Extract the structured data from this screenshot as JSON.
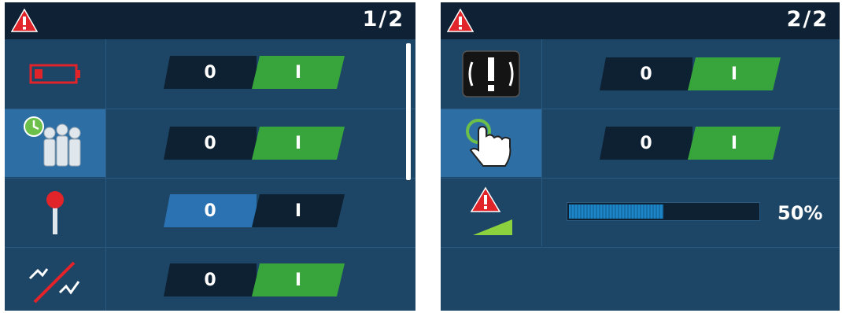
{
  "screens": [
    {
      "page_indicator": "1/2",
      "rows": [
        {
          "icon": "battery-low-icon",
          "toggle": {
            "off_label": "0",
            "on_label": "I",
            "state": "on"
          }
        },
        {
          "icon": "people-timer-icon",
          "selected": true,
          "toggle": {
            "off_label": "0",
            "on_label": "I",
            "state": "on"
          }
        },
        {
          "icon": "pin-icon",
          "toggle": {
            "off_label": "0",
            "on_label": "I",
            "state": "off"
          }
        },
        {
          "icon": "signal-disabled-icon",
          "toggle": {
            "off_label": "0",
            "on_label": "I",
            "state": "on"
          }
        }
      ]
    },
    {
      "page_indicator": "2/2",
      "rows": [
        {
          "icon": "alert-sign-icon",
          "toggle": {
            "off_label": "0",
            "on_label": "I",
            "state": "on"
          }
        },
        {
          "icon": "touch-hand-icon",
          "selected": true,
          "toggle": {
            "off_label": "0",
            "on_label": "I",
            "state": "on"
          }
        },
        {
          "icon": "warning-level-icon",
          "progress": {
            "value_fraction": 0.5,
            "label": "50%"
          }
        }
      ]
    }
  ],
  "colors": {
    "background": "#1d4566",
    "titlebar": "#0f2235",
    "on_green": "#37a53c",
    "off_blue": "#2a72b2",
    "warning_red": "#e0242a"
  }
}
